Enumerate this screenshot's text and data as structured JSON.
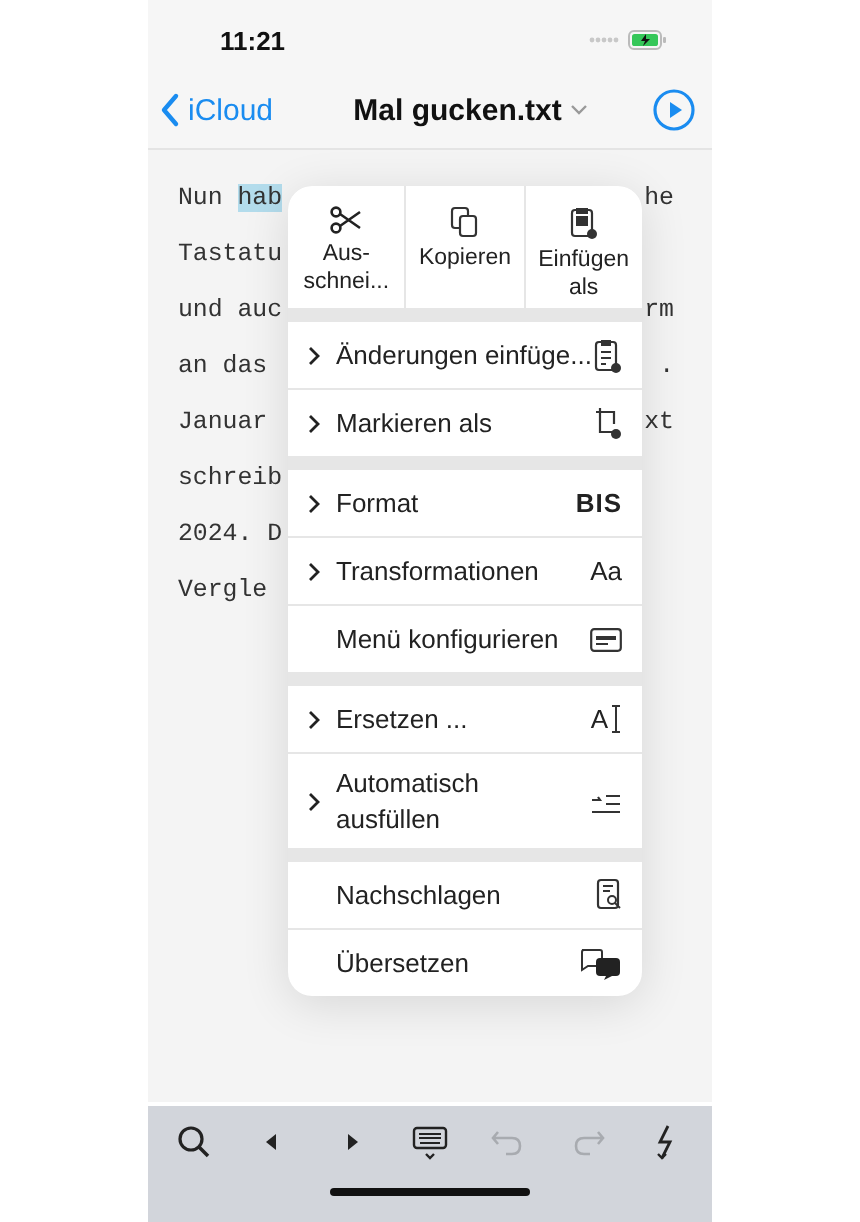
{
  "status_bar": {
    "time": "11:21"
  },
  "nav": {
    "back": "iCloud",
    "title": "Mal gucken.txt"
  },
  "editor": {
    "lines": [
      {
        "left": "Nun ",
        "selection": "hab",
        "right": "he"
      },
      {
        "left": "Tastatu"
      },
      {
        "left": "und auc",
        "right": "rm"
      },
      {
        "left": "an das",
        "right": "."
      },
      {
        "left": "Januar",
        "right": "xt"
      },
      {
        "left": "schreib"
      },
      {
        "left": "2024. D"
      },
      {
        "left": "Vergle"
      }
    ]
  },
  "context_menu": {
    "actions": [
      {
        "label": "Aus-\nschnei..."
      },
      {
        "label": "Kopieren"
      },
      {
        "label": "Einfügen\nals"
      }
    ],
    "sections": [
      {
        "items": [
          {
            "label": "Änderungen einfüge...",
            "submenu": true
          },
          {
            "label": "Markieren als",
            "submenu": true
          }
        ]
      },
      {
        "items": [
          {
            "label": "Format",
            "submenu": true,
            "glyph": "BIS"
          },
          {
            "label": "Transformationen",
            "submenu": true,
            "glyph": "Aa"
          },
          {
            "label": "Menü konfigurieren",
            "submenu": false
          }
        ]
      },
      {
        "items": [
          {
            "label": "Ersetzen ...",
            "submenu": true,
            "glyph": "A"
          },
          {
            "label": "Automatisch\nausfüllen",
            "submenu": true
          }
        ]
      },
      {
        "items": [
          {
            "label": "Nachschlagen",
            "submenu": false
          },
          {
            "label": "Übersetzen",
            "submenu": false
          }
        ]
      }
    ]
  },
  "toolbar": [
    {
      "disabled": false
    },
    {
      "disabled": false
    },
    {
      "disabled": false
    },
    {
      "disabled": false
    },
    {
      "disabled": true
    },
    {
      "disabled": true
    },
    {
      "disabled": false
    }
  ]
}
